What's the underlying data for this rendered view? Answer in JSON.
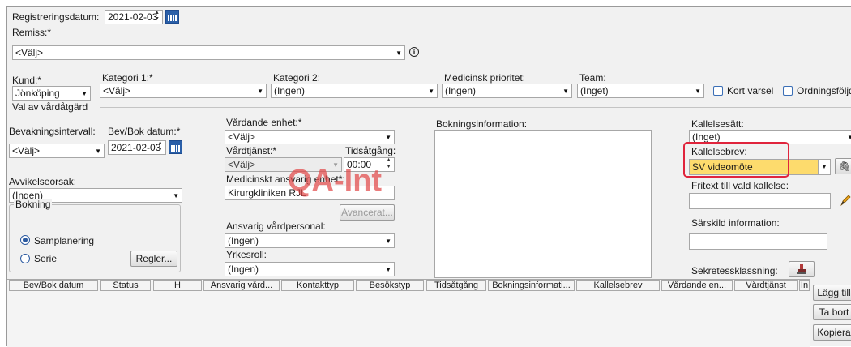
{
  "registration": {
    "label": "Registreringsdatum:",
    "value": "2021-02-03"
  },
  "remiss": {
    "label": "Remiss:*",
    "value": "<Välj>"
  },
  "kund": {
    "label": "Kund:*",
    "value": "Jönköping"
  },
  "kategori1": {
    "label": "Kategori 1:*",
    "value": "<Välj>"
  },
  "kategori2": {
    "label": "Kategori 2:",
    "value": "(Ingen)"
  },
  "prioritet": {
    "label": "Medicinsk prioritet:",
    "value": "(Ingen)"
  },
  "team": {
    "label": "Team:",
    "value": "(Inget)"
  },
  "kort_varsel": "Kort varsel",
  "ordningsfoljd": "Ordningsföljd",
  "section_title": "Val av vårdåtgärd",
  "bevakning": {
    "label": "Bevakningsintervall:",
    "value": "<Välj>"
  },
  "bevbok": {
    "label": "Bev/Bok datum:*",
    "value": "2021-02-03"
  },
  "vardande_enhet": {
    "label": "Vårdande enhet:*",
    "value": "<Välj>"
  },
  "vardtjanst": {
    "label": "Vårdtjänst:*",
    "value": "<Välj>"
  },
  "tidsatgang": {
    "label": "Tidsåtgång:",
    "value": "00:00"
  },
  "avvikelseorsak": {
    "label": "Avvikelseorsak:",
    "value": "(Ingen)"
  },
  "med_ansvarig_enhet": {
    "label": "Medicinskt ansvarig enhet*:",
    "value": "Kirurgkliniken RJL"
  },
  "avancerat": "Avancerat...",
  "watermark": "QA-Int",
  "bokning": {
    "title": "Bokning",
    "opt1": "Samplanering",
    "opt2": "Serie",
    "regler": "Regler..."
  },
  "ansvarig_vardpersonal": {
    "label": "Ansvarig vårdpersonal:",
    "value": "(Ingen)"
  },
  "yrkesroll": {
    "label": "Yrkesroll:",
    "value": "(Ingen)"
  },
  "bokningsinfo": {
    "label": "Bokningsinformation:"
  },
  "kallelsesatt": {
    "label": "Kallelsesätt:",
    "value": "(Inget)"
  },
  "kallelsebrev": {
    "label": "Kallelsebrev:",
    "value": "SV videomöte"
  },
  "fritext": {
    "label": "Fritext till vald kallelse:"
  },
  "sarskild": {
    "label": "Särskild information:"
  },
  "sekretess": {
    "label": "Sekretessklassning:"
  },
  "table": {
    "columns": [
      "Bev/Bok datum",
      "Status",
      "H",
      "Ansvarig vård...",
      "Kontakttyp",
      "Besökstyp",
      "Tidsåtgång",
      "Bokningsinformati...",
      "Kallelsebrev",
      "Vårdande en...",
      "Vårdtjänst",
      "In"
    ]
  },
  "side_buttons": {
    "add": "Lägg till",
    "remove": "Ta bort",
    "copy": "Kopiera"
  },
  "colors": {
    "highlight": "#fddb6d",
    "highlight_border": "#e0243c",
    "calendar": "#2a5fa8",
    "watermark": "#e24a4a"
  }
}
